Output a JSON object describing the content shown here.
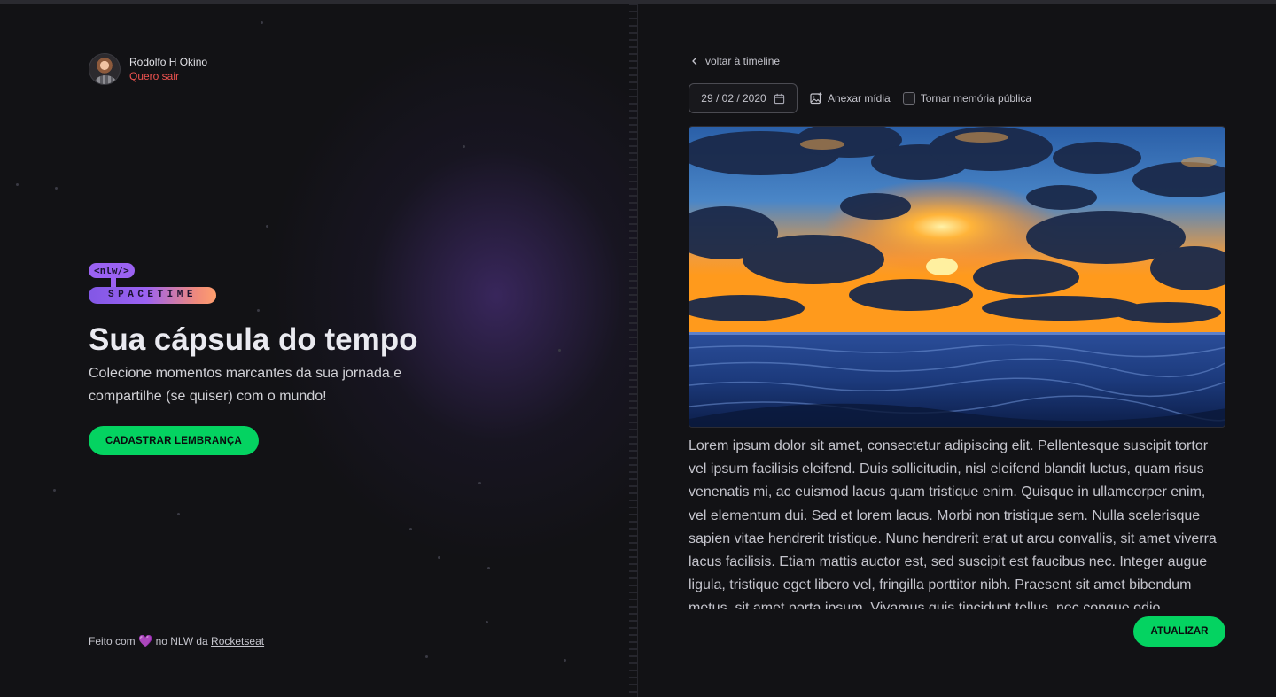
{
  "user": {
    "name": "Rodolfo H Okino",
    "logout_label": "Quero sair"
  },
  "brand": {
    "tag": "<nlw/>",
    "name": "SPACETIME"
  },
  "hero": {
    "title": "Sua cápsula do tempo",
    "subtitle": "Colecione momentos marcantes da sua jornada e compartilhe (se quiser) com o mundo!",
    "cta_label": "CADASTRAR LEMBRANÇA"
  },
  "footer": {
    "prefix": "Feito com",
    "heart": "💜",
    "middle": "no NLW da",
    "link": "Rocketseat"
  },
  "editor": {
    "back_label": "voltar à timeline",
    "date_value": "29 / 02 / 2020",
    "attach_label": "Anexar mídia",
    "public_label": "Tornar memória pública",
    "public_checked": false,
    "content": "Lorem ipsum dolor sit amet, consectetur adipiscing elit. Pellentesque suscipit tortor vel ipsum facilisis eleifend. Duis sollicitudin, nisl eleifend blandit luctus, quam risus venenatis mi, ac euismod lacus quam tristique enim. Quisque in ullamcorper enim, vel elementum dui. Sed et lorem lacus. Morbi non tristique sem. Nulla scelerisque sapien vitae hendrerit tristique. Nunc hendrerit erat ut arcu convallis, sit amet viverra lacus facilisis. Etiam mattis auctor est, sed suscipit est faucibus nec. Integer augue ligula, tristique eget libero vel, fringilla porttitor nibh. Praesent sit amet bibendum metus, sit amet porta ipsum. Vivamus quis tincidunt tellus, nec congue odio.",
    "update_label": "ATUALIZAR"
  },
  "icons": {
    "back": "chevron-left-icon",
    "calendar": "calendar-icon",
    "attach": "image-plus-icon",
    "heart": "heart-icon"
  },
  "colors": {
    "background": "#121215",
    "accent_green": "#04d361",
    "logout_red": "#ef5350",
    "brand_purple": "#9b62f2"
  }
}
